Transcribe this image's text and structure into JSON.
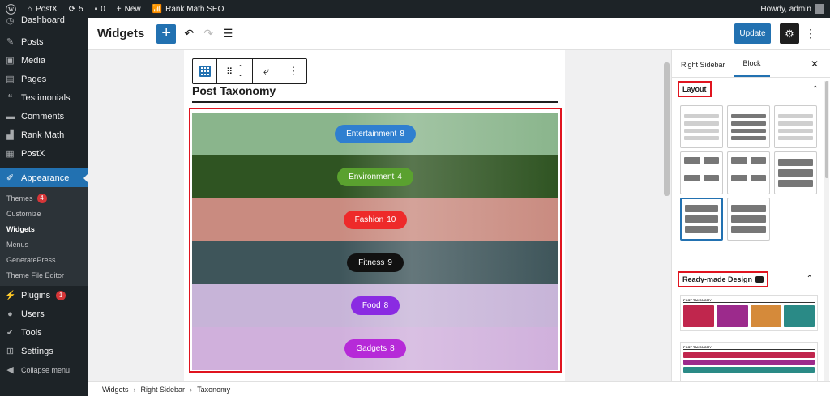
{
  "admin_bar": {
    "site_name": "PostX",
    "updates_count": "5",
    "comments_count": "0",
    "new_label": "New",
    "rank_math_label": "Rank Math SEO",
    "howdy": "Howdy, admin"
  },
  "sidebar": {
    "items": [
      {
        "label": "Dashboard",
        "icon": "dashboard-icon"
      },
      {
        "label": "Posts",
        "icon": "pin-icon"
      },
      {
        "label": "Media",
        "icon": "media-icon"
      },
      {
        "label": "Pages",
        "icon": "pages-icon"
      },
      {
        "label": "Testimonials",
        "icon": "quote-icon"
      },
      {
        "label": "Comments",
        "icon": "comment-icon"
      },
      {
        "label": "Rank Math",
        "icon": "chart-icon"
      },
      {
        "label": "PostX",
        "icon": "postx-icon"
      },
      {
        "label": "Appearance",
        "icon": "brush-icon"
      }
    ],
    "submenu": [
      {
        "label": "Themes",
        "badge": "4"
      },
      {
        "label": "Customize"
      },
      {
        "label": "Widgets"
      },
      {
        "label": "Menus"
      },
      {
        "label": "GeneratePress"
      },
      {
        "label": "Theme File Editor"
      }
    ],
    "items_after": [
      {
        "label": "Plugins",
        "icon": "plugin-icon",
        "badge": "1"
      },
      {
        "label": "Users",
        "icon": "user-icon"
      },
      {
        "label": "Tools",
        "icon": "tools-icon"
      },
      {
        "label": "Settings",
        "icon": "settings-icon"
      },
      {
        "label": "Collapse menu",
        "icon": "collapse-icon"
      }
    ]
  },
  "header": {
    "title": "Widgets",
    "update_label": "Update"
  },
  "block": {
    "title": "Post Taxonomy",
    "taxonomies": [
      {
        "name": "Entertainment",
        "count": "8",
        "color": "#2f7fd0",
        "bg": "#8ab58c"
      },
      {
        "name": "Environment",
        "count": "4",
        "color": "#5aa12f",
        "bg": "#2f5422"
      },
      {
        "name": "Fashion",
        "count": "10",
        "color": "#ee2a2a",
        "bg": "#c98b80"
      },
      {
        "name": "Fitness",
        "count": "9",
        "color": "#111111",
        "bg": "#3e555a"
      },
      {
        "name": "Food",
        "count": "8",
        "color": "#8a2be2",
        "bg": "#c7b4d8"
      },
      {
        "name": "Gadgets",
        "count": "8",
        "color": "#b62ad8",
        "bg": "#d0b0dc"
      }
    ]
  },
  "panel": {
    "tabs": [
      "Right Sidebar",
      "Block"
    ],
    "layout_label": "Layout",
    "ready_made_label": "Ready-made Design",
    "preview_title": "POST TAXONOMY"
  },
  "breadcrumb": [
    "Widgets",
    "Right Sidebar",
    "Taxonomy"
  ]
}
